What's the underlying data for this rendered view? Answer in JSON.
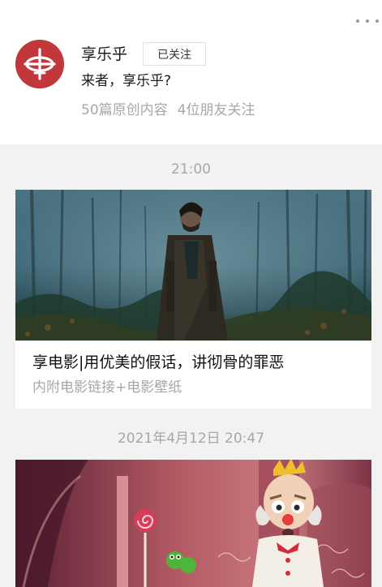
{
  "header": {
    "account_name": "享乐乎",
    "follow_label": "已关注",
    "description": "来者，享乐乎?",
    "articles_count": "50篇原创内容",
    "friends_following": "4位朋友关注",
    "more_icon": "more-dots-icon",
    "avatar_color": "#c2383a"
  },
  "feed": [
    {
      "timestamp": "21:00",
      "title": "享电影|用优美的假话，讲彻骨的罪恶",
      "subtitle": "内附电影链接+电影壁纸",
      "cover": "forest-man-coat-cover"
    },
    {
      "timestamp": "2021年4月12日 20:47",
      "cover": "cartoon-king-candy-cover"
    }
  ]
}
